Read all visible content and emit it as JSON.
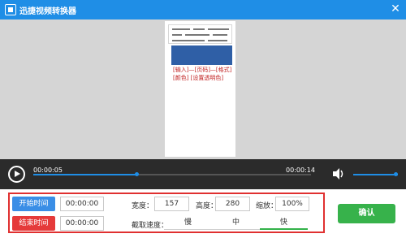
{
  "window": {
    "title": "迅捷视频转换器",
    "icons": {
      "app": "app-logo-icon",
      "close": "close-icon"
    },
    "close_glyph": "✕"
  },
  "preview": {
    "doc_lines": [
      "[输入]—[页码]—[格式]",
      "[颜色]  [设置透明色]"
    ]
  },
  "player": {
    "current_time": "00:00:05",
    "total_time": "00:00:14",
    "progress": 0.37,
    "volume": 0.9,
    "icons": {
      "play": "play-icon",
      "volume": "volume-icon"
    }
  },
  "settings": {
    "start_label": "开始时间",
    "start_value": "00:00:00",
    "end_label": "结束时间",
    "end_value": "00:00:00",
    "width_label": "宽度：",
    "width_value": "157",
    "height_label": "高度：",
    "height_value": "280",
    "zoom_label": "缩放：",
    "zoom_value": "100%",
    "speed_label": "截取速度：",
    "speed_options": [
      "慢",
      "中",
      "快"
    ],
    "speed_selected": "快"
  },
  "confirm_label": "确认",
  "colors": {
    "title_bar": "#1f8ee6",
    "preview_bg": "#d5d5d5",
    "control_bar": "#2b2b2b",
    "accent_blue": "#1f8ee6",
    "settings_border": "#e03030",
    "start_button": "#3a8ee6",
    "end_button": "#e53a3a",
    "confirm_button": "#37b24b",
    "selected_speed": "#33b24a"
  }
}
